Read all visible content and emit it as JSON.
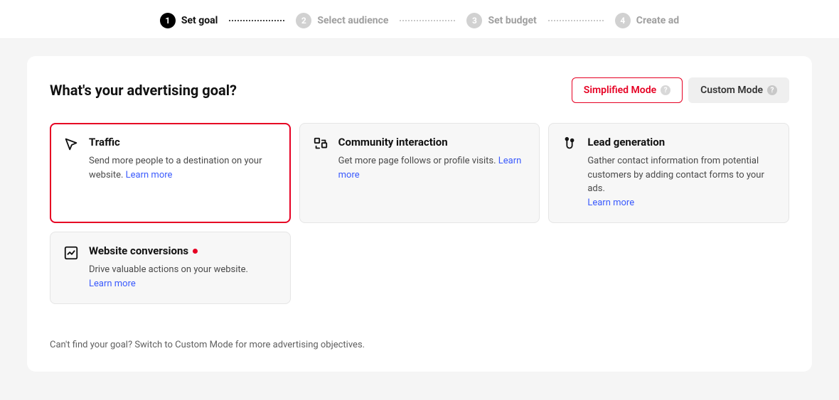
{
  "stepper": {
    "steps": [
      {
        "num": "1",
        "label": "Set goal",
        "active": true
      },
      {
        "num": "2",
        "label": "Select audience",
        "active": false
      },
      {
        "num": "3",
        "label": "Set budget",
        "active": false
      },
      {
        "num": "4",
        "label": "Create ad",
        "active": false
      }
    ]
  },
  "header": {
    "title": "What's your advertising goal?",
    "simplified_label": "Simplified Mode",
    "custom_label": "Custom Mode"
  },
  "goals": {
    "traffic": {
      "title": "Traffic",
      "desc": "Send more people to a destination on your website. ",
      "learn_more": "Learn more"
    },
    "community": {
      "title": "Community interaction",
      "desc": "Get more page follows or profile visits. ",
      "learn_more": "Learn more"
    },
    "lead": {
      "title": "Lead generation",
      "desc": "Gather contact information from potential customers by adding contact forms to your ads.",
      "learn_more": "Learn more"
    },
    "conversions": {
      "title": "Website conversions",
      "desc": "Drive valuable actions on your website.",
      "learn_more": "Learn more"
    }
  },
  "footer": {
    "note": "Can't find your goal? Switch to Custom Mode for more advertising objectives."
  }
}
